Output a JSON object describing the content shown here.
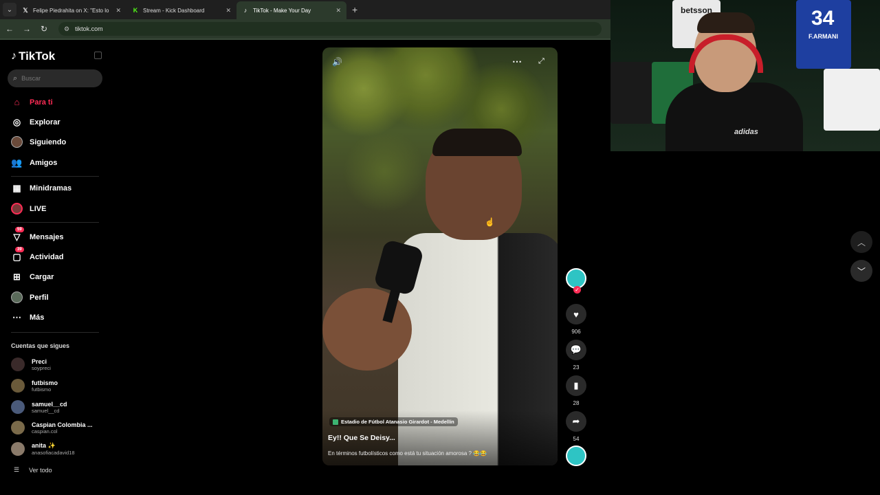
{
  "browser": {
    "tabs": [
      {
        "favicon": "x-icon",
        "title": "Felipe Piedrahita on X: \"Esto lo"
      },
      {
        "favicon": "kick-icon",
        "title": "Stream - Kick Dashboard"
      },
      {
        "favicon": "tiktok-icon",
        "title": "TikTok - Make Your Day",
        "active": true
      }
    ],
    "url": "tiktok.com"
  },
  "sidebar": {
    "logo": "TikTok",
    "search_placeholder": "Buscar",
    "nav": [
      {
        "label": "Para ti",
        "icon": "home-icon",
        "active": true
      },
      {
        "label": "Explorar",
        "icon": "compass-icon"
      },
      {
        "label": "Siguiendo",
        "icon": "avatar-icon"
      },
      {
        "label": "Amigos",
        "icon": "friends-icon"
      },
      {
        "label": "Minidramas",
        "icon": "film-icon"
      },
      {
        "label": "LIVE",
        "icon": "live-icon"
      },
      {
        "label": "Mensajes",
        "icon": "messages-icon",
        "badge": "59"
      },
      {
        "label": "Actividad",
        "icon": "activity-icon",
        "badge": "39"
      },
      {
        "label": "Cargar",
        "icon": "upload-icon"
      },
      {
        "label": "Perfil",
        "icon": "profile-icon"
      },
      {
        "label": "Más",
        "icon": "more-icon"
      }
    ],
    "following_title": "Cuentas que sigues",
    "accounts": [
      {
        "name": "Preci",
        "handle": "soypreci",
        "color": "#3a2a2a"
      },
      {
        "name": "futbismo",
        "handle": "futbismo",
        "color": "#6a5a3a"
      },
      {
        "name": "samuel__cd",
        "handle": "samuel__cd",
        "color": "#4a5a7a"
      },
      {
        "name": "Caspian Colombia ...",
        "handle": "caspian.col",
        "color": "#7a6a4a"
      },
      {
        "name": "anita ✨",
        "handle": "anasofiacadavid18",
        "color": "#8a7a6a"
      }
    ],
    "see_all": "Ver todo"
  },
  "video": {
    "location": "Estadio de Fútbol Atanasio Girardot - Medellín",
    "title": "Ey!! Que Se Deisy...",
    "description": "En términos futbolísticos como está tu situación amorosa ? 😂😂"
  },
  "actions": {
    "likes": "906",
    "comments": "23",
    "saves": "28",
    "shares": "54"
  },
  "webcam": {
    "text_bet": "betsson",
    "text_number": "34",
    "text_name": "F.ARMANI",
    "text_sponsor": "adidas"
  }
}
